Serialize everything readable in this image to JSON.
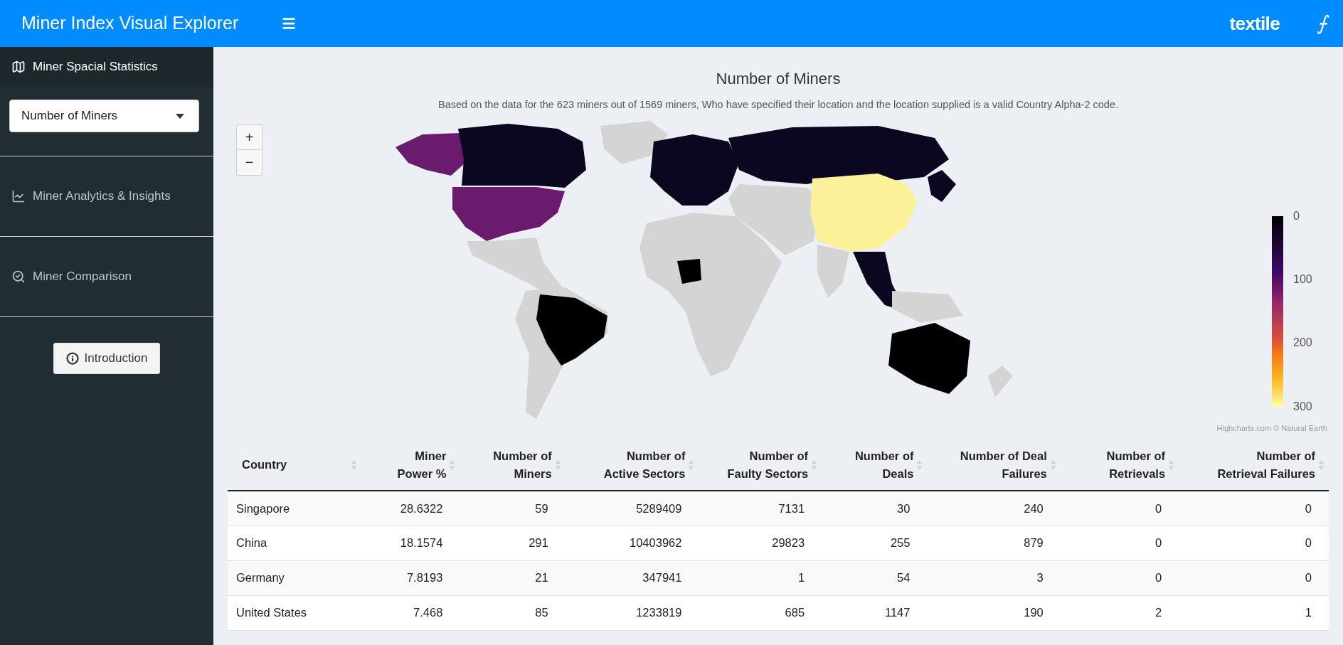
{
  "header": {
    "title": "Miner Index Visual Explorer",
    "brand": "textile",
    "brand_symbol": "⨍"
  },
  "sidebar": {
    "items": [
      {
        "label": "Miner Spacial Statistics",
        "selected": true
      },
      {
        "label": "Miner Analytics & Insights",
        "selected": false
      },
      {
        "label": "Miner Comparison",
        "selected": false
      }
    ],
    "select": {
      "value": "Number of Miners"
    },
    "button": {
      "label": "Introduction"
    }
  },
  "main": {
    "title": "Number of Miners",
    "subtitle": "Based on the data for the 623 miners out of 1569 miners, Who have specified their location and the location supplied is a valid Country Alpha-2 code.",
    "map": {
      "zoom_in": "+",
      "zoom_out": "−",
      "legend_ticks": [
        "0",
        "100",
        "200",
        "300"
      ],
      "credits": "Highcharts.com © Natural Earth"
    },
    "table": {
      "columns": [
        {
          "lines": [
            "Country"
          ]
        },
        {
          "lines": [
            "Miner",
            "Power %"
          ]
        },
        {
          "lines": [
            "Number of",
            "Miners"
          ]
        },
        {
          "lines": [
            "Number of",
            "Active Sectors"
          ]
        },
        {
          "lines": [
            "Number of",
            "Faulty Sectors"
          ]
        },
        {
          "lines": [
            "Number of",
            "Deals"
          ]
        },
        {
          "lines": [
            "Number of Deal",
            "Failures"
          ]
        },
        {
          "lines": [
            "Number of",
            "Retrievals"
          ]
        },
        {
          "lines": [
            "Number of",
            "Retrieval Failures"
          ]
        }
      ],
      "rows": [
        [
          "Singapore",
          "28.6322",
          "59",
          "5289409",
          "7131",
          "30",
          "240",
          "0",
          "0"
        ],
        [
          "China",
          "18.1574",
          "291",
          "10403962",
          "29823",
          "255",
          "879",
          "0",
          "0"
        ],
        [
          "Germany",
          "7.8193",
          "21",
          "347941",
          "1",
          "54",
          "3",
          "0",
          "0"
        ],
        [
          "United States",
          "7.468",
          "85",
          "1233819",
          "685",
          "1147",
          "190",
          "2",
          "1"
        ]
      ]
    }
  }
}
